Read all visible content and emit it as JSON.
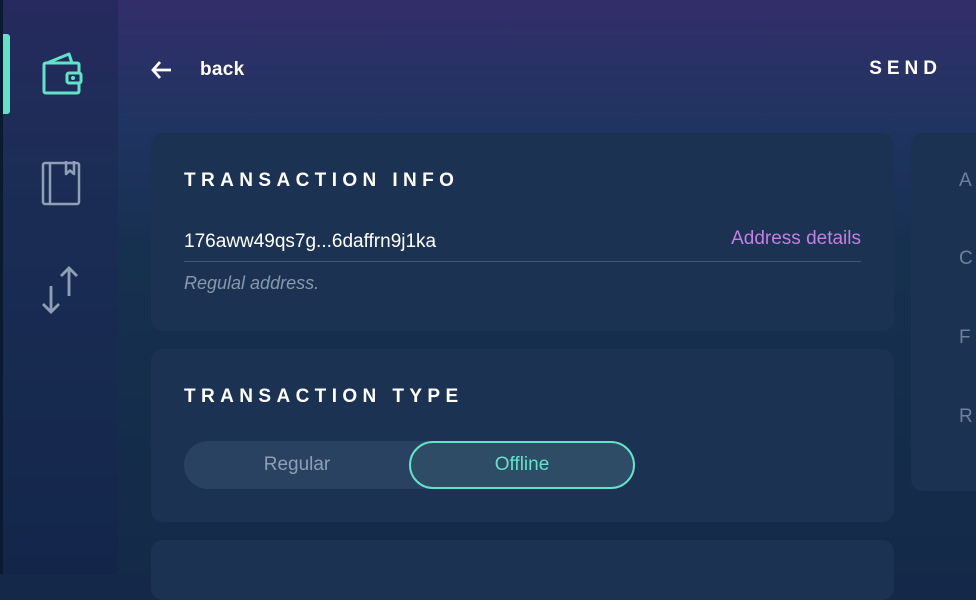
{
  "header": {
    "back_label": "back",
    "title": "SEND"
  },
  "sidebar": {
    "items": [
      {
        "name": "wallet",
        "active": true
      },
      {
        "name": "address-book",
        "active": false
      },
      {
        "name": "transactions",
        "active": false
      }
    ]
  },
  "transaction_info": {
    "title": "TRANSACTION INFO",
    "address": "176aww49qs7g...6daffrn9j1ka",
    "details_link": "Address details",
    "address_note": "Regulal address."
  },
  "transaction_type": {
    "title": "TRANSACTION TYPE",
    "options": [
      "Regular",
      "Offline"
    ],
    "selected": "Offline"
  },
  "right_panel": {
    "labels": [
      "A",
      "C",
      "F",
      "R"
    ]
  },
  "colors": {
    "accent": "#62e3c8",
    "link": "#c47fe0",
    "card": "#1b3253"
  }
}
